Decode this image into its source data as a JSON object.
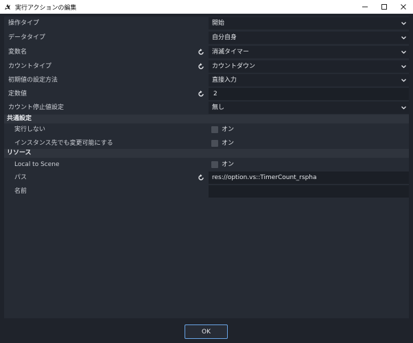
{
  "window": {
    "title": "実行アクションの編集",
    "icon": "godot-action-icon"
  },
  "properties": [
    {
      "label": "操作タイプ",
      "value": "開始",
      "kind": "select",
      "reset": false
    },
    {
      "label": "データタイプ",
      "value": "自分自身",
      "kind": "select",
      "reset": false
    },
    {
      "label": "変数名",
      "value": "消滅タイマー",
      "kind": "select",
      "reset": true
    },
    {
      "label": "カウントタイプ",
      "value": "カウントダウン",
      "kind": "select",
      "reset": true
    },
    {
      "label": "初期値の設定方法",
      "value": "直接入力",
      "kind": "select",
      "reset": false
    },
    {
      "label": "定数値",
      "value": "2",
      "kind": "input",
      "reset": true
    },
    {
      "label": "カウント停止値設定",
      "value": "無し",
      "kind": "select",
      "reset": false
    }
  ],
  "sections": {
    "common": {
      "title": "共通設定",
      "items": [
        {
          "label": "実行しない",
          "check_label": "オン",
          "checked": false
        },
        {
          "label": "インスタンス先でも変更可能にする",
          "check_label": "オン",
          "checked": false
        }
      ]
    },
    "resource": {
      "title": "リソース",
      "local_to_scene": {
        "label": "Local to Scene",
        "check_label": "オン",
        "checked": false
      },
      "path": {
        "label": "パス",
        "value": "res://option.vs::TimerCount_rspha",
        "reset": true
      },
      "name": {
        "label": "名前",
        "value": ""
      }
    }
  },
  "footer": {
    "ok_label": "OK"
  },
  "colors": {
    "accent": "#6aa5e6",
    "panel": "#262b34",
    "section": "#2f343d",
    "field": "#1e222a"
  }
}
